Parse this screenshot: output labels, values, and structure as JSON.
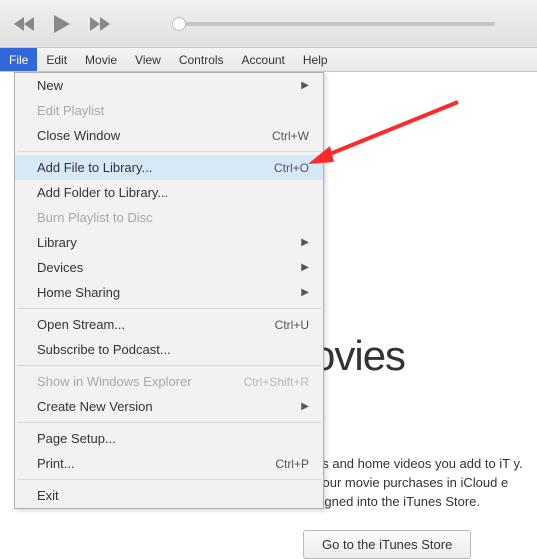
{
  "menubar": [
    "File",
    "Edit",
    "Movie",
    "View",
    "Controls",
    "Account",
    "Help"
  ],
  "menubar_active": 0,
  "dropdown": {
    "groups": [
      [
        {
          "label": "New",
          "submenu": true
        },
        {
          "label": "Edit Playlist",
          "disabled": true
        },
        {
          "label": "Close Window",
          "shortcut": "Ctrl+W"
        }
      ],
      [
        {
          "label": "Add File to Library...",
          "shortcut": "Ctrl+O",
          "hover": true
        },
        {
          "label": "Add Folder to Library..."
        },
        {
          "label": "Burn Playlist to Disc",
          "disabled": true
        },
        {
          "label": "Library",
          "submenu": true
        },
        {
          "label": "Devices",
          "submenu": true
        },
        {
          "label": "Home Sharing",
          "submenu": true
        }
      ],
      [
        {
          "label": "Open Stream...",
          "shortcut": "Ctrl+U"
        },
        {
          "label": "Subscribe to Podcast..."
        }
      ],
      [
        {
          "label": "Show in Windows Explorer",
          "shortcut": "Ctrl+Shift+R",
          "disabled": true
        },
        {
          "label": "Create New Version",
          "submenu": true
        }
      ],
      [
        {
          "label": "Page Setup..."
        },
        {
          "label": "Print...",
          "shortcut": "Ctrl+P"
        }
      ],
      [
        {
          "label": "Exit"
        }
      ]
    ]
  },
  "content": {
    "heading": "ovies",
    "body": "es and home videos you add to iT\ny. Your movie purchases in iCloud\ne signed into the iTunes Store.",
    "store_button": "Go to the iTunes Store"
  }
}
